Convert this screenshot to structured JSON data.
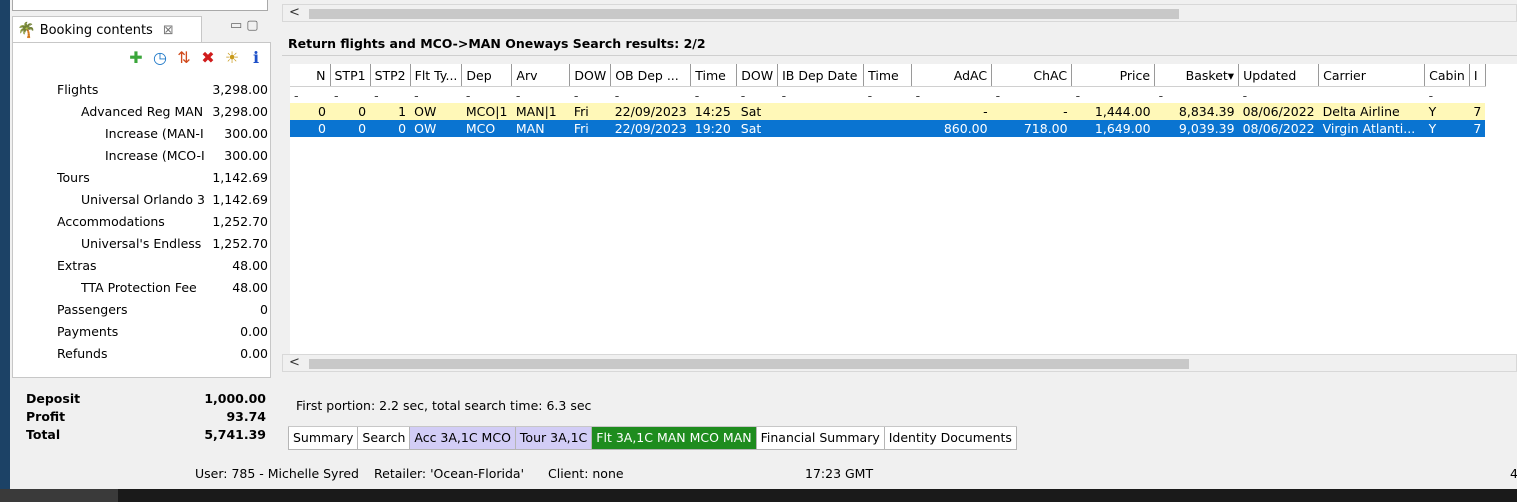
{
  "booking": {
    "panel_title": "Booking contents",
    "close_glyph": "⊠",
    "toolbar_icons": [
      "add-icon",
      "clock-icon",
      "transfer-icon",
      "delete-icon",
      "holiday-icon",
      "info-icon"
    ],
    "tree": [
      {
        "label": "Flights",
        "value": "3,298.00",
        "indent": 0
      },
      {
        "label": "Advanced Reg MAN",
        "value": "3,298.00",
        "indent": 1
      },
      {
        "label": "Increase (MAN-I",
        "value": "300.00",
        "indent": 2
      },
      {
        "label": "Increase (MCO-I",
        "value": "300.00",
        "indent": 2
      },
      {
        "label": "Tours",
        "value": "1,142.69",
        "indent": 0
      },
      {
        "label": "Universal Orlando 3",
        "value": "1,142.69",
        "indent": 1
      },
      {
        "label": "Accommodations",
        "value": "1,252.70",
        "indent": 0
      },
      {
        "label": "Universal's Endless !",
        "value": "1,252.70",
        "indent": 1
      },
      {
        "label": "Extras",
        "value": "48.00",
        "indent": 0
      },
      {
        "label": "TTA Protection Fee",
        "value": "48.00",
        "indent": 1
      },
      {
        "label": "Passengers",
        "value": "0",
        "indent": 0
      },
      {
        "label": "Payments",
        "value": "0.00",
        "indent": 0
      },
      {
        "label": "Refunds",
        "value": "0.00",
        "indent": 0
      }
    ],
    "summary": [
      {
        "label": "Deposit",
        "value": "1,000.00"
      },
      {
        "label": "Profit",
        "value": "93.74"
      },
      {
        "label": "Total",
        "value": "5,741.39"
      }
    ]
  },
  "results": {
    "title": "Return flights and MCO->MAN Oneways Search results: 2/2",
    "columns": [
      {
        "label": "N",
        "width": 40,
        "align": "right"
      },
      {
        "label": "STP1",
        "width": 40,
        "align": "right"
      },
      {
        "label": "STP2",
        "width": 40,
        "align": "right"
      },
      {
        "label": "Flt Ty...",
        "width": 50,
        "align": "left"
      },
      {
        "label": "Dep",
        "width": 50,
        "align": "left"
      },
      {
        "label": "Arv",
        "width": 58,
        "align": "left"
      },
      {
        "label": "DOW",
        "width": 38,
        "align": "left"
      },
      {
        "label": "OB Dep ...",
        "width": 74,
        "align": "left"
      },
      {
        "label": "Time",
        "width": 46,
        "align": "left"
      },
      {
        "label": "DOW",
        "width": 38,
        "align": "left"
      },
      {
        "label": "IB Dep Date",
        "width": 86,
        "align": "left"
      },
      {
        "label": "Time",
        "width": 48,
        "align": "left"
      },
      {
        "label": "AdAC",
        "width": 80,
        "align": "right"
      },
      {
        "label": "ChAC",
        "width": 80,
        "align": "right"
      },
      {
        "label": "Price",
        "width": 83,
        "align": "right"
      },
      {
        "label": "Basket▾",
        "width": 84,
        "align": "right"
      },
      {
        "label": "Updated",
        "width": 78,
        "align": "left"
      },
      {
        "label": "Carrier",
        "width": 106,
        "align": "left"
      },
      {
        "label": "Cabin",
        "width": 42,
        "align": "left"
      },
      {
        "label": "I",
        "width": 14,
        "align": "left"
      }
    ],
    "filter_row": [
      "-",
      "-",
      "-",
      "-",
      "-",
      "-",
      "-",
      "-",
      "-",
      "-",
      "-",
      "-",
      "-",
      "-",
      "-",
      "-",
      "-",
      "",
      "-",
      ""
    ],
    "rows": [
      [
        "0",
        "0",
        "1",
        "OW",
        "MCO|1",
        "MAN|1",
        "Fri",
        "22/09/2023",
        "14:25",
        "Sat",
        "",
        "",
        "-",
        "-",
        "1,444.00",
        "8,834.39",
        "08/06/2022",
        "Delta Airline",
        "Y",
        "7"
      ],
      [
        "0",
        "0",
        "0",
        "OW",
        "MCO",
        "MAN",
        "Fri",
        "22/09/2023",
        "19:20",
        "Sat",
        "",
        "",
        "860.00",
        "718.00",
        "1,649.00",
        "9,039.39",
        "08/06/2022",
        "Virgin Atlanti...",
        "Y",
        "7"
      ]
    ],
    "info": "First portion: 2.2 sec, total search time: 6.3 sec"
  },
  "tabs": [
    {
      "label": "Summary",
      "color": "#ffffff",
      "text": "#000000"
    },
    {
      "label": "Search",
      "color": "#ffffff",
      "text": "#000000"
    },
    {
      "label": "Acc 3A,1C MCO",
      "color": "#d2cdf6",
      "text": "#000000"
    },
    {
      "label": "Tour 3A,1C",
      "color": "#d2cdf6",
      "text": "#000000"
    },
    {
      "label": "Flt 3A,1C MAN MCO MAN",
      "color": "#1e8c1e",
      "text": "#ffffff"
    },
    {
      "label": "Financial Summary",
      "color": "#ffffff",
      "text": "#000000"
    },
    {
      "label": "Identity Documents",
      "color": "#ffffff",
      "text": "#000000"
    }
  ],
  "status": {
    "user": "User: 785 - Michelle Syred",
    "retailer": "Retailer: 'Ocean-Florida'",
    "client": "Client: none",
    "time": "17:23 GMT",
    "right": "4"
  }
}
